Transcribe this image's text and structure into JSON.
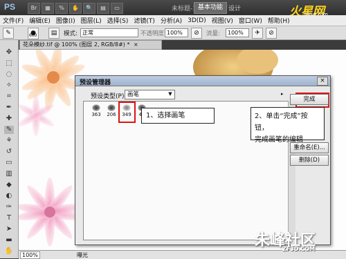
{
  "titlebar": {
    "app_logo": "PS",
    "doc_title": "未标题-1",
    "workspace_button": "基本功能",
    "design_button": "设计",
    "brand_logo": "火星网",
    "brand_sub": "hxsd.com"
  },
  "menubar": {
    "items": [
      "文件(F)",
      "编辑(E)",
      "图像(I)",
      "图层(L)",
      "选择(S)",
      "滤镜(T)",
      "分析(A)",
      "3D(D)",
      "视图(V)",
      "窗口(W)",
      "帮助(H)"
    ]
  },
  "optionsbar": {
    "brush_size": "600",
    "mode_label": "模式:",
    "mode_value": "正常",
    "opacity_label": "不透明度:",
    "opacity_value": "100%",
    "flow_label": "流量:",
    "flow_value": "100%"
  },
  "document": {
    "tab_title": "花朵模纱.tif @ 100% (图层 2, RGB/8#) *",
    "tab_close": "×",
    "zoom": "100%",
    "status": "曝光"
  },
  "dialog": {
    "title": "预设管理器",
    "close": "×",
    "preset_type_label": "预设类型(P):",
    "preset_type_value": "画笔",
    "brushes": [
      "363",
      "206",
      "349",
      "40"
    ],
    "buttons": {
      "done": "完成",
      "rename": "重命名(E)...",
      "delete": "删除(D)"
    }
  },
  "annotations": {
    "step1": "1、选择画笔",
    "step2_line1": "2、单击“完成”按钮，",
    "step2_line2": "完成画笔的编辑"
  },
  "watermark": {
    "text": "朱峰社区",
    "sub": "ZF3D.COM"
  },
  "colors": {
    "highlight": "#d11111",
    "dialog_title": "#9fb3cf"
  }
}
